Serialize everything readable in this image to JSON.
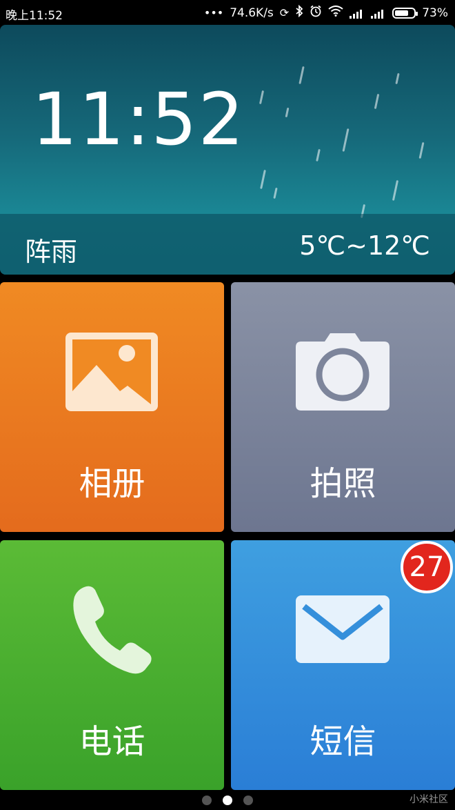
{
  "statusbar": {
    "time": "晚上11:52",
    "network_speed": "74.6K/s",
    "battery": "73%",
    "battery_level": 0.73,
    "icons": [
      "more-dots-icon",
      "sync-icon",
      "bluetooth-icon",
      "alarm-icon",
      "wifi-icon",
      "signal-icon",
      "signal-icon",
      "battery-icon"
    ]
  },
  "weather": {
    "time": "11:52",
    "condition": "阵雨",
    "temperature": "5℃~12℃"
  },
  "tiles": {
    "album": {
      "label": "相册",
      "icon": "gallery-icon",
      "color": "#ee8021"
    },
    "camera": {
      "label": "拍照",
      "icon": "camera-icon",
      "color": "#7d859b"
    },
    "phone": {
      "label": "电话",
      "icon": "phone-icon",
      "color": "#4cb030"
    },
    "sms": {
      "label": "短信",
      "icon": "mail-icon",
      "color": "#348fdb",
      "badge": "27"
    }
  },
  "pager": {
    "pages": 3,
    "active": 1
  },
  "watermark": "小米社区"
}
